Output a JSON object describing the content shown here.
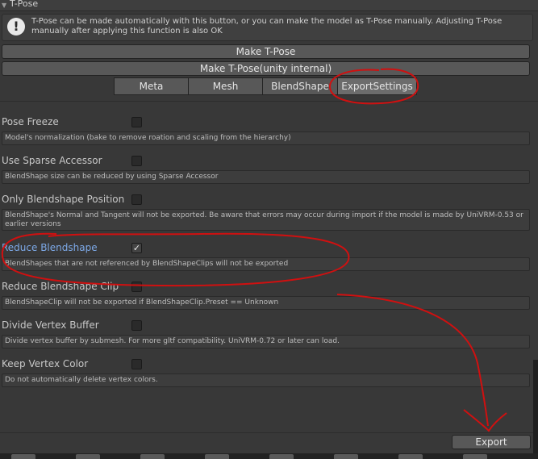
{
  "section": {
    "title": "T-Pose",
    "collapse_icon": "triangle-down-icon"
  },
  "help": {
    "icon": "info-icon",
    "icon_glyph": "!",
    "message": "T-Pose can be made automatically with this button, or you can make the model as T-Pose manually. Adjusting T-Pose manually after applying this function is also OK"
  },
  "buttons": {
    "make_tpose": "Make T-Pose",
    "make_tpose_internal": "Make T-Pose(unity internal)",
    "export": "Export"
  },
  "tabs": [
    {
      "label": "Meta",
      "active": false
    },
    {
      "label": "Mesh",
      "active": false
    },
    {
      "label": "BlendShape",
      "active": false
    },
    {
      "label": "ExportSettings",
      "active": true
    }
  ],
  "settings": [
    {
      "label": "Pose Freeze",
      "checked": false,
      "highlight": false,
      "description": "Model's normalization (bake to remove roation and scaling from the hierarchy)"
    },
    {
      "label": "Use Sparse Accessor",
      "checked": false,
      "highlight": false,
      "description": "BlendShape size can be reduced by using Sparse Accessor"
    },
    {
      "label": "Only Blendshape Position",
      "checked": false,
      "highlight": false,
      "description": "BlendShape's Normal and Tangent will not be exported. Be aware that errors may occur during import if the model is made by UniVRM-0.53 or earlier versions"
    },
    {
      "label": "Reduce Blendshape",
      "checked": true,
      "highlight": true,
      "description": "BlendShapes that are not referenced by BlendShapeClips will not be exported"
    },
    {
      "label": "Reduce Blendshape Clip",
      "checked": false,
      "highlight": false,
      "description": "BlendShapeClip will not be exported if BlendShapeClip.Preset == Unknown"
    },
    {
      "label": "Divide Vertex Buffer",
      "checked": false,
      "highlight": false,
      "description": "Divide vertex buffer by submesh. For more gltf compatibility. UniVRM-0.72 or later can load."
    },
    {
      "label": "Keep Vertex Color",
      "checked": false,
      "highlight": false,
      "description": "Do not automatically delete vertex colors."
    }
  ],
  "colors": {
    "background": "#383838",
    "button": "#585858",
    "highlight_label": "#7da9e8",
    "annotation": "#d01010"
  }
}
